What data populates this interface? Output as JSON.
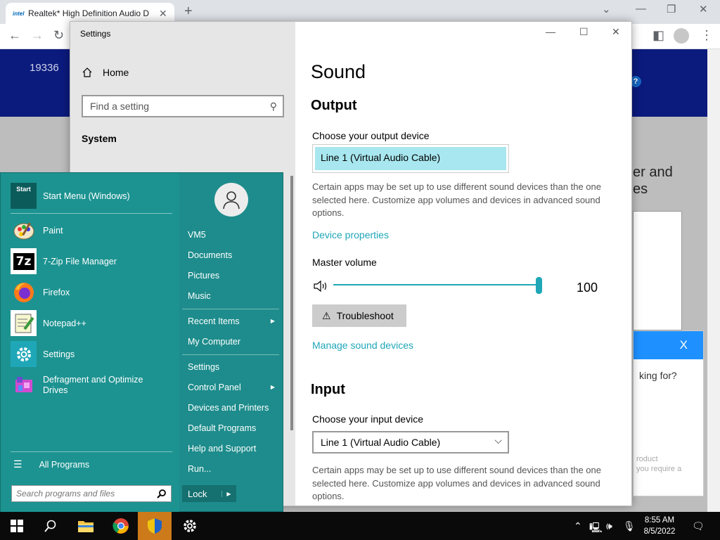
{
  "browser": {
    "tab_title": "Realtek* High Definition Audio D",
    "tab_favicon": "intel",
    "tab_close": "✕",
    "new_tab": "+",
    "banner_number": "19336",
    "help_badge": "?",
    "bg_text_1": "er and",
    "bg_text_2": "es",
    "chat_close": "X",
    "chat_question": "king for?",
    "chat_small_1": "roduct",
    "chat_small_2": "you require a"
  },
  "settings": {
    "app_title": "Settings",
    "home_label": "Home",
    "search_placeholder": "Find a setting",
    "system_label": "System",
    "page_title": "Sound",
    "output": {
      "heading": "Output",
      "device_label": "Choose your output device",
      "device_value": "Line 1 (Virtual Audio Cable)",
      "description": "Certain apps may be set up to use different sound devices than the one selected here. Customize app volumes and devices in advanced sound options.",
      "device_properties_link": "Device properties",
      "master_volume_label": "Master volume",
      "volume_value": "100",
      "volume_level": 1.0,
      "troubleshoot_label": "Troubleshoot",
      "manage_link": "Manage sound devices"
    },
    "input": {
      "heading": "Input",
      "device_label": "Choose your input device",
      "device_value": "Line 1 (Virtual Audio Cable)",
      "description": "Certain apps may be set up to use different sound devices than the one selected here. Customize app volumes and devices in advanced sound options."
    }
  },
  "start_menu": {
    "pinned": [
      {
        "label": "Start Menu (Windows)",
        "icon": "start-menu-icon"
      },
      {
        "label": "Paint",
        "icon": "paint-icon"
      },
      {
        "label": "7-Zip File Manager",
        "icon": "7zip-icon"
      },
      {
        "label": "Firefox",
        "icon": "firefox-icon"
      },
      {
        "label": "Notepad++",
        "icon": "notepadpp-icon"
      },
      {
        "label": "Settings",
        "icon": "gear-icon"
      },
      {
        "label": "Defragment and Optimize Drives",
        "icon": "defrag-icon"
      }
    ],
    "start_icon_text": "Start",
    "all_programs": "All Programs",
    "search_placeholder": "Search programs and files",
    "right_items": {
      "vm5": "VM5",
      "documents": "Documents",
      "pictures": "Pictures",
      "music": "Music",
      "recent_items": "Recent Items",
      "my_computer": "My Computer",
      "settings": "Settings",
      "control_panel": "Control Panel",
      "devices_printers": "Devices and Printers",
      "default_programs": "Default Programs",
      "help_support": "Help and Support",
      "run": "Run..."
    },
    "lock_label": "Lock"
  },
  "taskbar": {
    "time": "8:55 AM",
    "date": "8/5/2022",
    "colors": {
      "active": "#cc7a1a",
      "background": "#0a0a0a"
    }
  },
  "colors": {
    "accent": "#1fa7b8",
    "start_menu": "#1c9391",
    "selected_device": "#a8e7ef"
  }
}
